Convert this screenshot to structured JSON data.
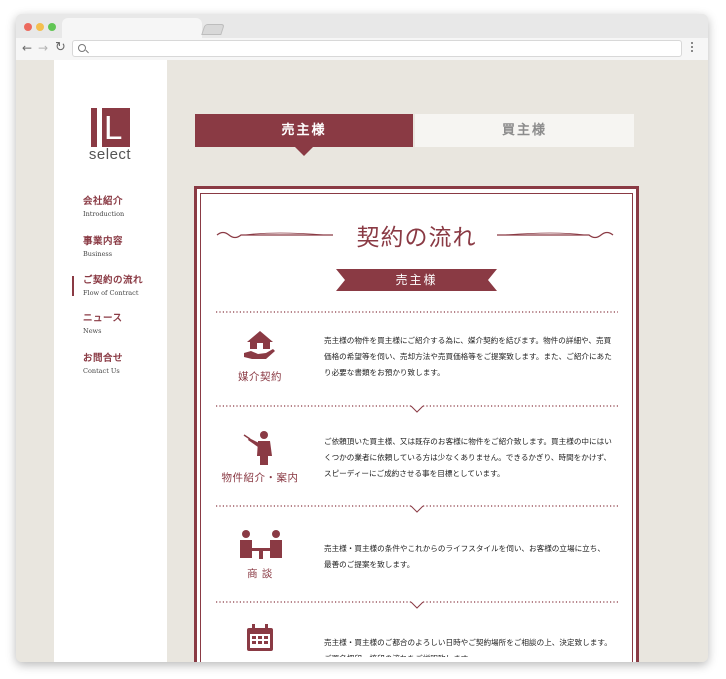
{
  "colors": {
    "brand": "#8a3a44",
    "background": "#e9e6df",
    "inactive_tab": "#f6f5f2"
  },
  "browser": {
    "traffic_lights": [
      "#ec6a5e",
      "#f4bf4f",
      "#61c554"
    ],
    "back_icon": "back-arrow-icon",
    "forward_icon": "forward-arrow-icon",
    "reload_icon": "reload-icon",
    "search_icon": "magnifier-icon",
    "address": ""
  },
  "sidebar": {
    "logo_letter": "L",
    "logo_word": "select",
    "items": [
      {
        "label": "会社紹介",
        "sub": "Introduction"
      },
      {
        "label": "事業内容",
        "sub": "Business"
      },
      {
        "label": "ご契約の流れ",
        "sub": "Flow of Contract"
      },
      {
        "label": "ニュース",
        "sub": "News"
      },
      {
        "label": "お問合せ",
        "sub": "Contact Us"
      }
    ]
  },
  "tabs": {
    "seller": "売主様",
    "buyer": "買主様"
  },
  "main": {
    "title": "契約の流れ",
    "ribbon": "売主様",
    "steps": [
      {
        "label": "媒介契約",
        "icon": "house-in-hand-icon",
        "text": "売主様の物件を買主様にご紹介する為に、媒介契約を結びます。物件の詳細や、売買価格の希望等を伺い、売却方法や売買価格等をご提案致します。また、ご紹介にあたり必要な書類をお預かり致します。"
      },
      {
        "label": "物件紹介・案内",
        "icon": "presenter-icon",
        "text": "ご依頼頂いた買主様、又は既存のお客様に物件をご紹介致します。買主様の中にはいくつかの業者に依頼している方は少なくありません。できるかぎり、時間をかけず、スピーディーにご成約させる事を目標としています。"
      },
      {
        "label": "商 談",
        "icon": "meeting-icon",
        "text": "売主様・買主様の条件やこれからのライフスタイルを伺い、お客様の立場に立ち、最善のご提案を致します。"
      },
      {
        "label": "",
        "icon": "calendar-icon",
        "text": "売主様・買主様のご都合のよろしい日時やご契約場所をご相談の上、決定致します。ご署名押印・捺印の流れをご説明致します。"
      }
    ]
  }
}
